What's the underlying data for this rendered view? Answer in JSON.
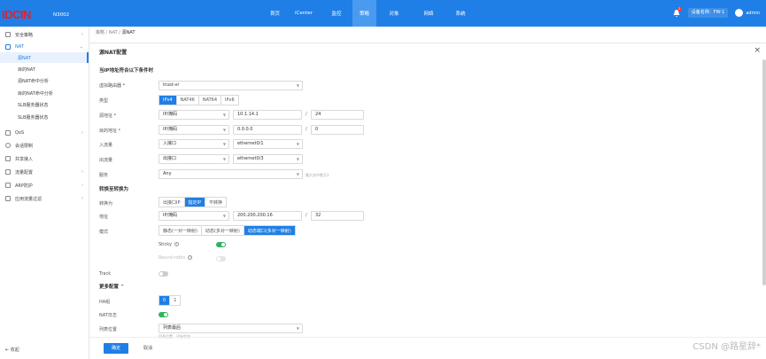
{
  "header": {
    "logo": "IDCIN",
    "model": "N3002",
    "nav": [
      "首页",
      "iCenter",
      "监控",
      "策略",
      "对象",
      "网络",
      "系统"
    ],
    "active_nav": 3,
    "notify_count": "2",
    "device_label": "设备名称：FW-1",
    "user": "admin"
  },
  "sidebar": {
    "items": [
      {
        "label": "安全策略",
        "arrow": "›"
      },
      {
        "label": "NAT",
        "arrow": "⌄"
      },
      {
        "label": "源NAT"
      },
      {
        "label": "目的NAT"
      },
      {
        "label": "源NAT命中分析"
      },
      {
        "label": "目的NAT命中分析"
      },
      {
        "label": "SLB服务器状态"
      },
      {
        "label": "SLB服务器状态"
      },
      {
        "label": "QoS",
        "arrow": "›"
      },
      {
        "label": "会话限制"
      },
      {
        "label": "共享接入"
      },
      {
        "label": "流量配置",
        "arrow": "›"
      },
      {
        "label": "ARP防护",
        "arrow": "›"
      },
      {
        "label": "应用流量过滤",
        "arrow": "›"
      }
    ],
    "collapse": "收起"
  },
  "breadcrumb": {
    "path": "策略 / NAT / ",
    "current": "源NAT"
  },
  "panel": {
    "title": "源NAT配置",
    "close": "×"
  },
  "form": {
    "section1": "当IP地址符合以下条件时",
    "vrouter_label": "虚拟路由器 *",
    "vrouter_value": "trust-vr",
    "type_label": "类型",
    "type_options": [
      "IPv4",
      "NAT46",
      "NAT64",
      "IPv6"
    ],
    "type_selected": 0,
    "src_label": "源地址 *",
    "src_kind": "IP/掩码",
    "src_ip": "10.1.14.1",
    "src_mask": "24",
    "dst_label": "目的地址 *",
    "dst_kind": "IP/掩码",
    "dst_ip": "0.0.0.0",
    "dst_mask": "0",
    "in_label": "入流量",
    "in_kind": "入接口",
    "in_if": "ethernet0/1",
    "out_label": "出流量",
    "out_kind": "出接口",
    "out_if": "ethernet0/3",
    "svc_label": "服务",
    "svc_value": "Any",
    "svc_hint": "最大选中数为1",
    "section2": "转换至转换为",
    "trans_label": "转换为",
    "trans_options": [
      "出接口IP",
      "指定IP",
      "不转换"
    ],
    "trans_selected": 1,
    "addr_label": "地址",
    "addr_kind": "IP/掩码",
    "addr_ip": "200.200.200.16",
    "addr_mask": "32",
    "mode_label": "模式",
    "mode_options": [
      "静态(一对一映射)",
      "动态(多对一映射)",
      "动态端口(多对一映射)"
    ],
    "mode_selected": 2,
    "sticky_label": "Sticky",
    "roundrobin_label": "Round-robin",
    "track_label": "Track",
    "more_label": "更多配置 ⌃",
    "ha_label": "HA组",
    "ha_options": [
      "0",
      "1"
    ],
    "ha_selected": 0,
    "natlog_label": "NAT日志",
    "pos_label": "列表位置",
    "pos_value": "列表最后",
    "pos_hint": "列表位置，初始状态",
    "ok": "确定",
    "cancel": "取消"
  },
  "watermark": "CSDN @路星辞*"
}
